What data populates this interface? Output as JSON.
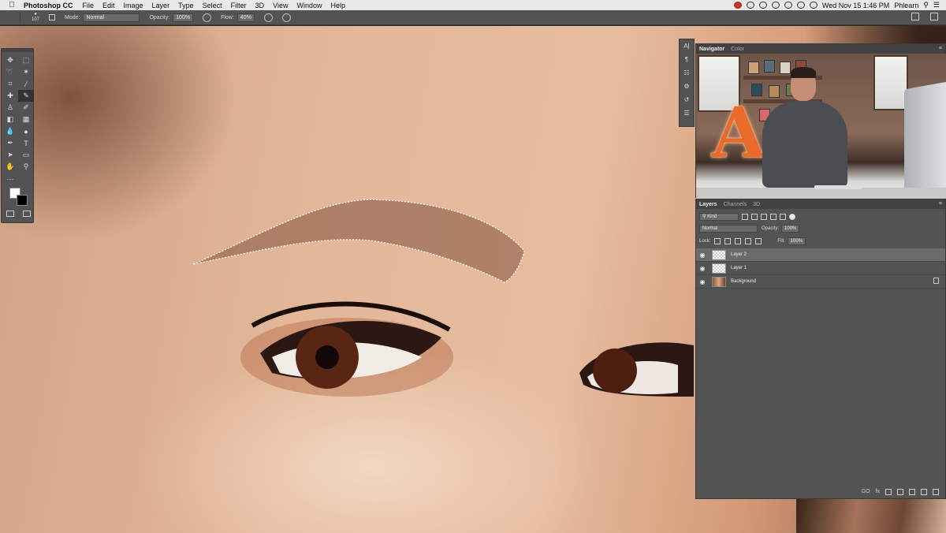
{
  "menubar": {
    "app": "Photoshop CC",
    "items": [
      "File",
      "Edit",
      "Image",
      "Layer",
      "Type",
      "Select",
      "Filter",
      "3D",
      "View",
      "Window",
      "Help"
    ],
    "clock": "Wed Nov 15  1:46 PM",
    "user": "Phlearn"
  },
  "options_bar": {
    "brush_size": "107",
    "mode_label": "Mode:",
    "mode_value": "Normal",
    "opacity_label": "Opacity:",
    "opacity_value": "100%",
    "flow_label": "Flow:",
    "flow_value": "40%"
  },
  "navigator": {
    "tabs": [
      "Navigator",
      "Color"
    ],
    "sign_letter": "A"
  },
  "layers_panel": {
    "tabs": [
      "Layers",
      "Channels",
      "3D"
    ],
    "filter_kind": "Kind",
    "blend_mode": "Normal",
    "opacity_label": "Opacity:",
    "opacity_value": "100%",
    "lock_label": "Lock:",
    "fill_label": "Fill:",
    "fill_value": "100%",
    "layers": [
      {
        "name": "Layer 2",
        "selected": true
      },
      {
        "name": "Layer 1",
        "selected": false
      },
      {
        "name": "Background",
        "selected": false,
        "locked": true
      }
    ],
    "footer_link": "GO",
    "footer_fx": "fx"
  },
  "tools": {
    "type_tool_glyph": "T"
  },
  "colors": {
    "foreground": "#ffffff",
    "background": "#000000",
    "ui_panel": "#535353"
  }
}
